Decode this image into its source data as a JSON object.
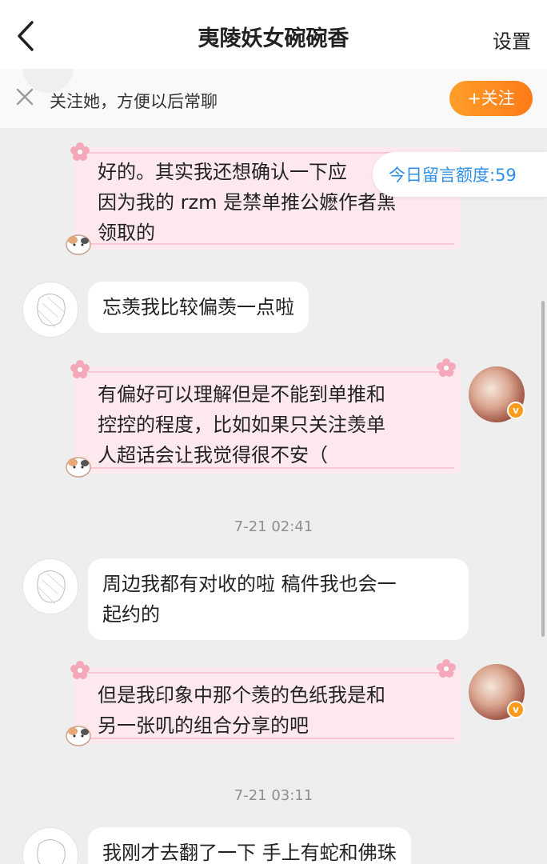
{
  "header": {
    "title": "夷陵妖女碗碗香",
    "settings_label": "设置"
  },
  "follow_bar": {
    "text": "关注她，方便以后常聊",
    "button_label": "+关注"
  },
  "quota": {
    "label": "今日留言额度:59"
  },
  "messages": [
    {
      "side": "right",
      "text": "好的。其实我还想确认一下应\n因为我的 rzm 是禁单推公嬷作者黑\n领取的"
    },
    {
      "side": "left",
      "text": "忘羡我比较偏羡一点啦"
    },
    {
      "side": "right",
      "text": "有偏好可以理解但是不能到单推和\n控控的程度，比如如果只关注羡单\n人超话会让我觉得很不安（"
    },
    {
      "side": "left",
      "text": "周边我都有对收的啦 稿件我也会一\n起约的"
    },
    {
      "side": "right",
      "text": "但是我印象中那个羡的色纸我是和\n另一张叽的组合分享的吧"
    },
    {
      "side": "left",
      "text": "我刚才去翻了一下 手上有蛇和佛珠"
    }
  ],
  "timestamps": [
    "7-21 02:41",
    "7-21 03:11"
  ],
  "colors": {
    "accent_orange": "#ff8c1f",
    "quota_blue": "#2d8fe6",
    "pink_bubble": "#fde8ee"
  },
  "icons": {
    "back": "chevron-left-icon",
    "close": "close-icon",
    "verified": "verified-badge-icon"
  }
}
